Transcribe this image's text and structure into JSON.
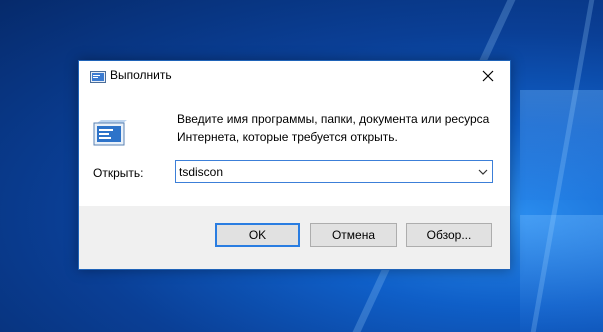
{
  "window": {
    "title": "Выполнить"
  },
  "dialog": {
    "description": "Введите имя программы, папки, документа или ресурса Интернета, которые требуется открыть.",
    "open_label": "Открыть:",
    "command_value": "tsdiscon"
  },
  "buttons": {
    "ok": "OK",
    "cancel": "Отмена",
    "browse": "Обзор..."
  },
  "icons": {
    "title": "run-icon",
    "close": "close-icon",
    "dropdown": "chevron-down-icon"
  },
  "colors": {
    "accent": "#2a7de1",
    "desktop": "#0a3f96"
  }
}
